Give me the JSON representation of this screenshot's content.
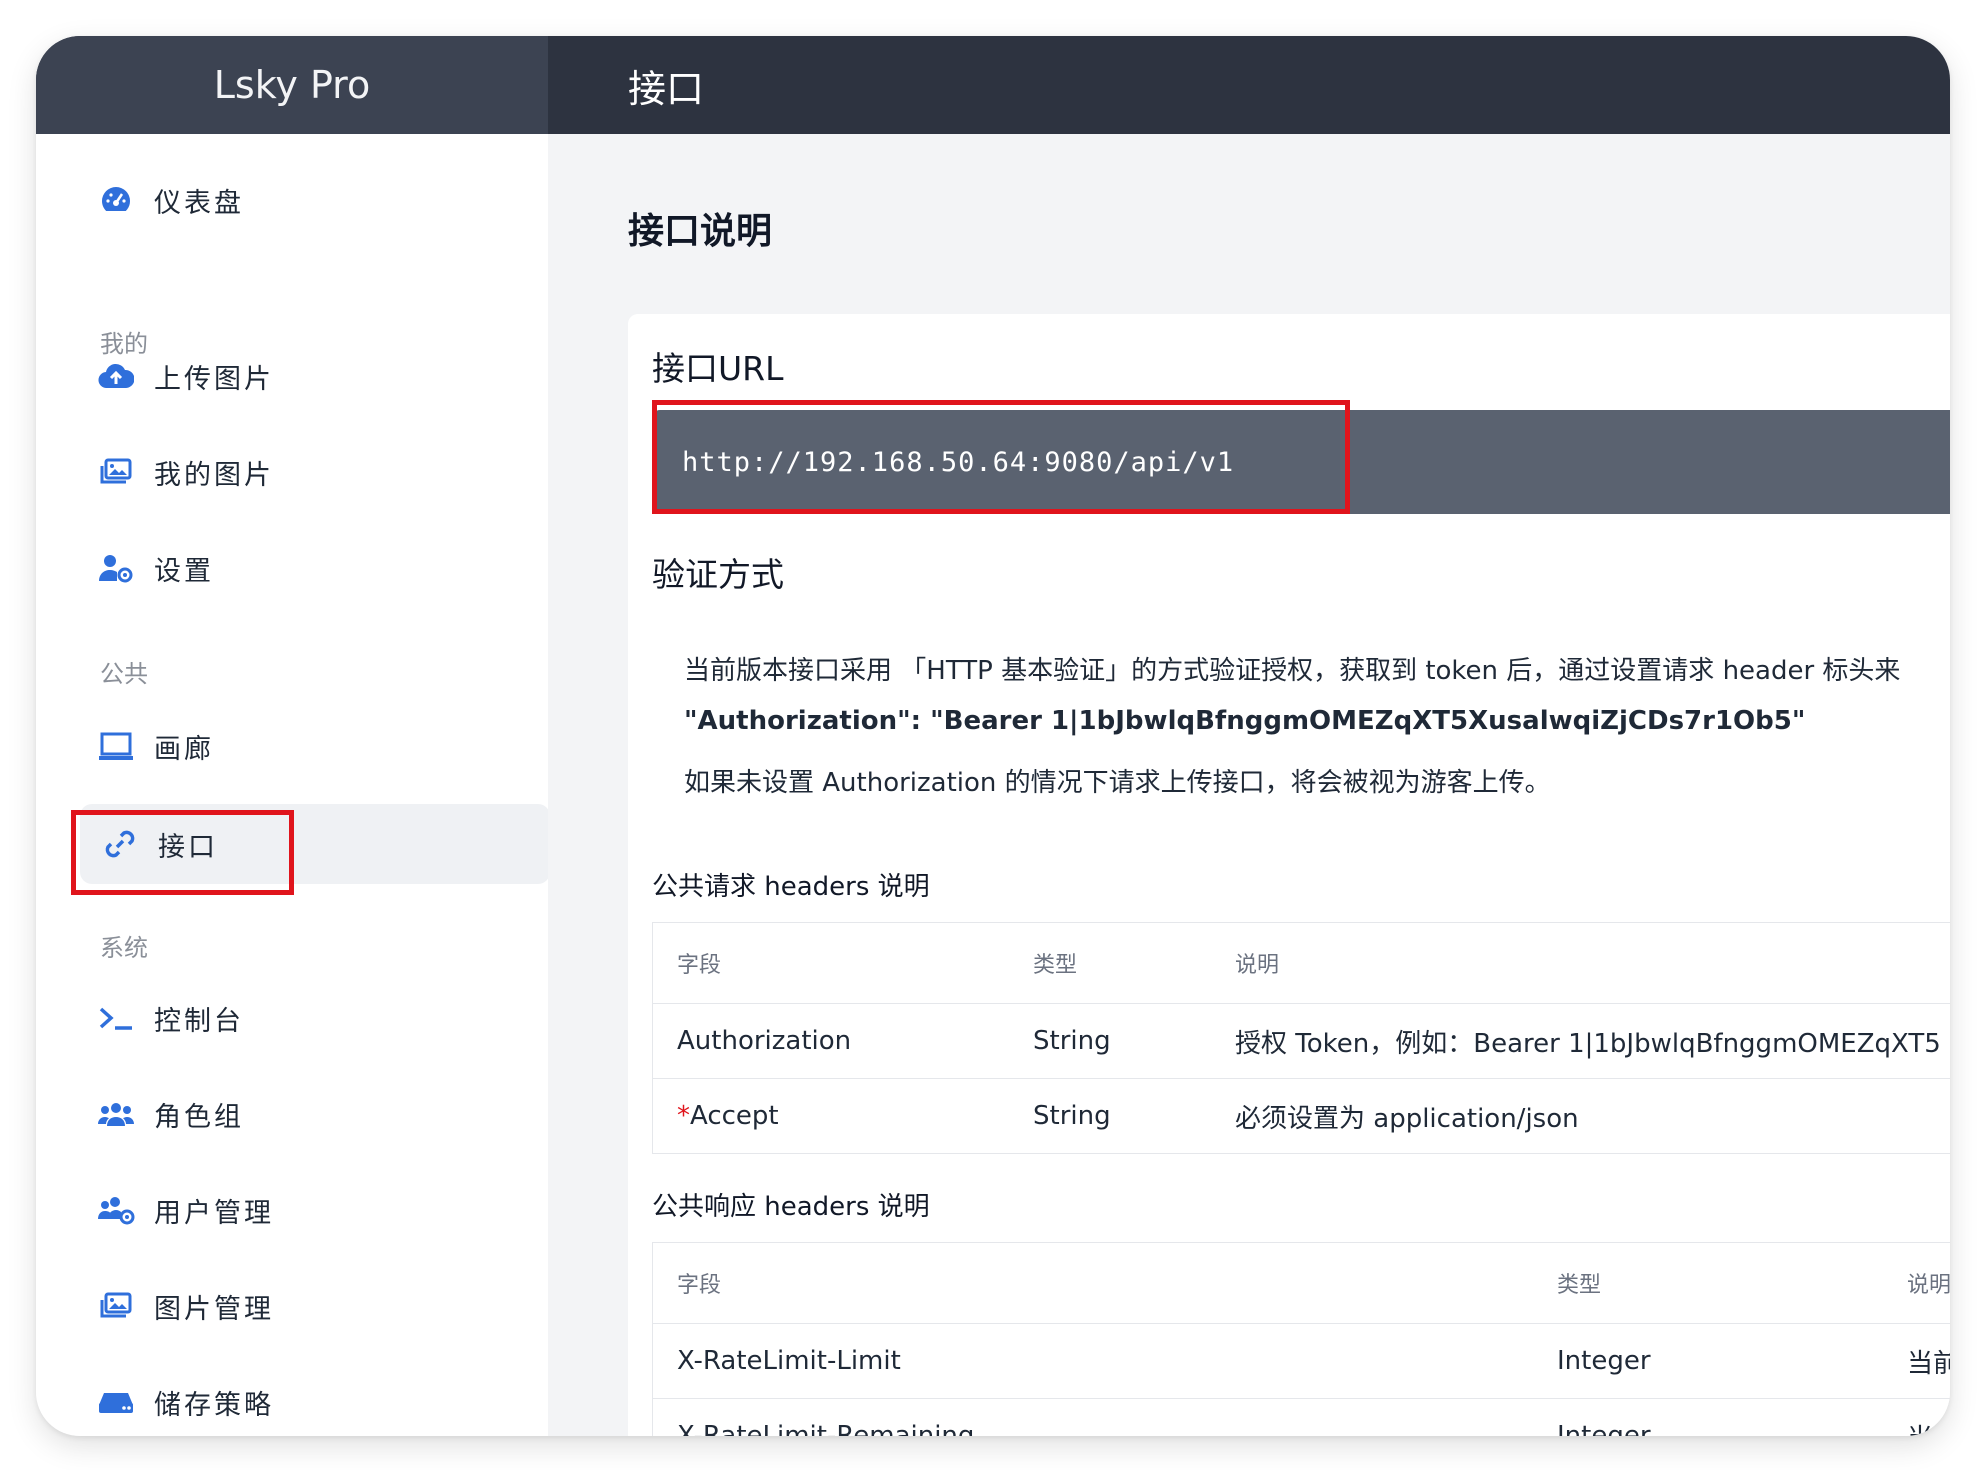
{
  "app": {
    "brand": "Lsky Pro",
    "page_title": "接口"
  },
  "sidebar": {
    "items": [
      {
        "label": "仪表盘",
        "icon": "dashboard-icon"
      },
      {
        "section": "我的"
      },
      {
        "label": "上传图片",
        "icon": "cloud-upload-icon"
      },
      {
        "label": "我的图片",
        "icon": "images-icon"
      },
      {
        "label": "设置",
        "icon": "user-settings-icon"
      },
      {
        "section": "公共"
      },
      {
        "label": "画廊",
        "icon": "gallery-icon"
      },
      {
        "label": "接口",
        "icon": "link-icon",
        "active": true
      },
      {
        "section": "系统"
      },
      {
        "label": "控制台",
        "icon": "terminal-icon"
      },
      {
        "label": "角色组",
        "icon": "users-icon"
      },
      {
        "label": "用户管理",
        "icon": "users-settings-icon"
      },
      {
        "label": "图片管理",
        "icon": "images-manage-icon"
      },
      {
        "label": "储存策略",
        "icon": "storage-icon"
      }
    ]
  },
  "main": {
    "section_title": "接口说明",
    "api_url_title": "接口URL",
    "api_url": "http://192.168.50.64:9080/api/v1",
    "auth_title": "验证方式",
    "auth_paragraph_1": "当前版本接口采用 「HTTP 基本验证」的方式验证授权，获取到 token 后，通过设置请求 header 标头来",
    "auth_paragraph_2": "\"Authorization\": \"Bearer 1|1bJbwlqBfnggmOMEZqXT5XusalwqiZjCDs7r1Ob5\"",
    "auth_paragraph_3": "如果未设置 Authorization 的情况下请求上传接口，将会被视为游客上传。",
    "request_headers_title": "公共请求 headers 说明",
    "request_headers_table": {
      "columns": [
        "字段",
        "类型",
        "说明"
      ],
      "rows": [
        {
          "field": "Authorization",
          "required": false,
          "type": "String",
          "desc": "授权 Token，例如：Bearer 1|1bJbwlqBfnggmOMEZqXT5"
        },
        {
          "field": "Accept",
          "required": true,
          "required_mark": "*",
          "type": "String",
          "desc": "必须设置为 application/json"
        }
      ]
    },
    "response_headers_title": "公共响应 headers 说明",
    "response_headers_table": {
      "columns": [
        "字段",
        "类型",
        "说明"
      ],
      "rows": [
        {
          "field": "X-RateLimit-Limit",
          "type": "Integer",
          "desc": "当前"
        },
        {
          "field": "X-RateLimit-Remaining",
          "type": "Integer",
          "desc": "当前"
        }
      ]
    }
  },
  "colors": {
    "topbar": "#2d3340",
    "brand_bg": "#3c4352",
    "accent": "#2f6fdb",
    "code_bg": "#5a6270",
    "highlight": "#e0141c"
  }
}
